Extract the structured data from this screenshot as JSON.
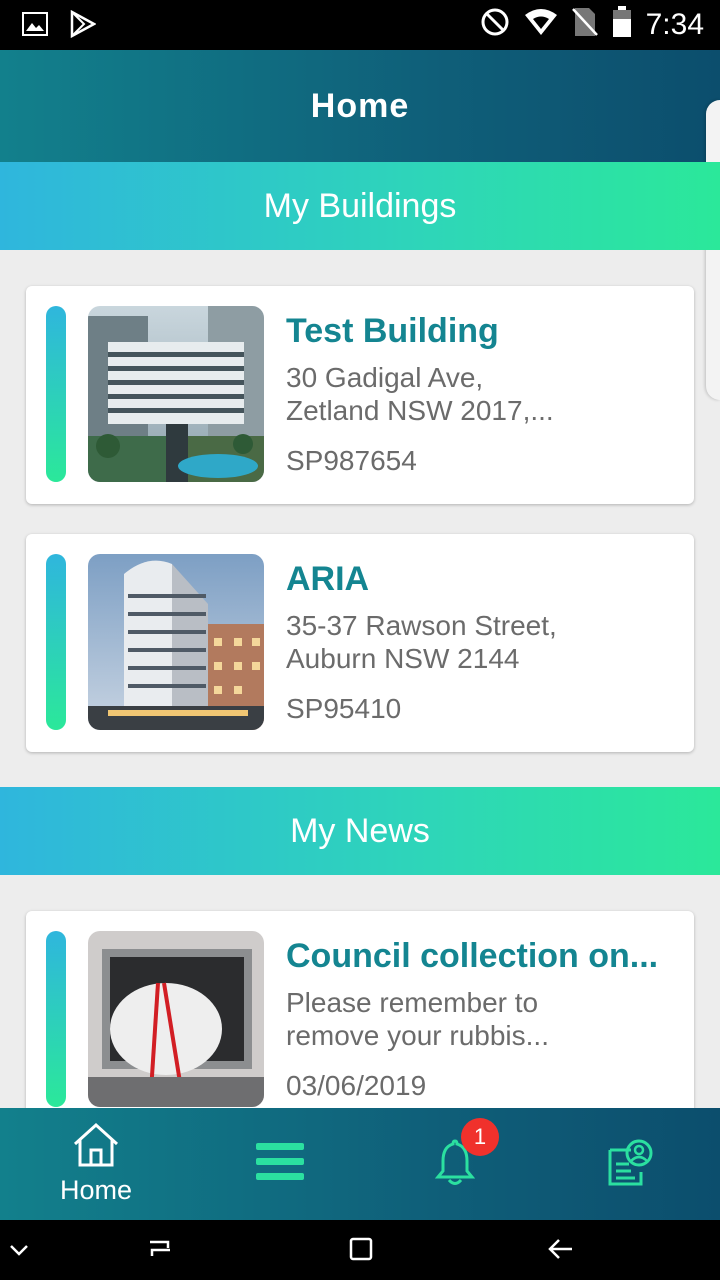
{
  "status_bar": {
    "time": "7:34",
    "left_icons": [
      "image-icon",
      "play-store-icon"
    ],
    "right_icons": [
      "do-not-disturb-icon",
      "wifi-icon",
      "no-sim-icon",
      "battery-icon"
    ]
  },
  "header": {
    "title": "Home"
  },
  "sections": {
    "buildings": {
      "title": "My Buildings"
    },
    "news": {
      "title": "My News"
    }
  },
  "buildings": [
    {
      "name": "Test Building",
      "address": "30 Gadigal Ave,\nZetland NSW 2017,...",
      "plan": "SP987654"
    },
    {
      "name": "ARIA",
      "address": "35-37 Rawson Street,\nAuburn NSW 2144",
      "plan": "SP95410"
    }
  ],
  "news": [
    {
      "title": "Council collection on...",
      "excerpt": "Please remember to\nremove your rubbis...",
      "date": "03/06/2019"
    }
  ],
  "bottom_nav": {
    "home_label": "Home",
    "notification_count": "1",
    "items": [
      "home-icon",
      "menu-icon",
      "bell-icon",
      "contact-card-icon"
    ]
  },
  "colors": {
    "accent": "#148591",
    "header_dark": "#0c4e6d",
    "gradient_start": "#2fb6dd",
    "gradient_end": "#2be89a",
    "badge": "#f0312c"
  }
}
